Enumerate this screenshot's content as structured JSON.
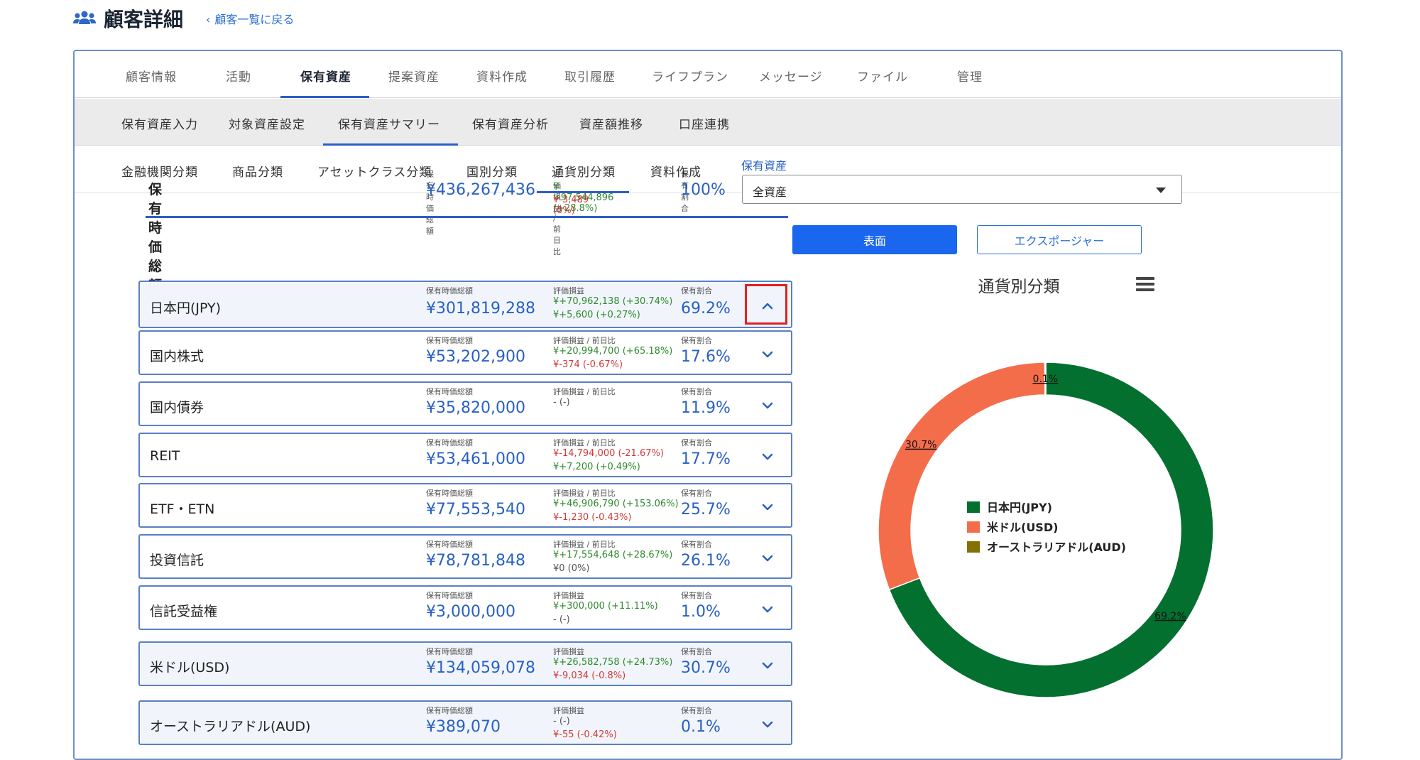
{
  "header": {
    "title": "顧客詳細",
    "back_link": "顧客一覧に戻る"
  },
  "tabs_primary": [
    "顧客情報",
    "活動",
    "保有資産",
    "提案資産",
    "資料作成",
    "取引履歴",
    "ライフプラン",
    "メッセージ",
    "ファイル",
    "管理"
  ],
  "tabs_secondary": [
    "保有資産入力",
    "対象資産設定",
    "保有資産サマリー",
    "保有資産分析",
    "資産額推移",
    "口座連携"
  ],
  "tabs_tertiary": [
    "金融機関分類",
    "商品分類",
    "アセットクラス分類",
    "国別分類",
    "通貨別分類",
    "資料作成"
  ],
  "summary": {
    "title": "保有時価総額",
    "value_label": "保有時価総額",
    "value": "¥436,267,436",
    "pl_label": "評価損益 / 前日比",
    "pl": "¥+97,544,896 (+28.8%)",
    "day": "¥-3,489 (0%)",
    "ratio_label": "保有割合",
    "ratio": "100%"
  },
  "rows": [
    {
      "label": "日本円(JPY)",
      "value_label": "保有時価総額",
      "value": "¥301,819,288",
      "pl_label": "評価損益",
      "pl": "¥+70,962,138 (+30.74%)",
      "day": "¥+5,600 (+0.27%)",
      "ratio_label": "保有割合",
      "ratio": "69.2%"
    },
    {
      "label": "国内株式",
      "value_label": "保有時価総額",
      "value": "¥53,202,900",
      "pl_label": "評価損益 / 前日比",
      "pl": "¥+20,994,700 (+65.18%)",
      "day": "¥-374 (-0.67%)",
      "ratio_label": "保有割合",
      "ratio": "17.6%"
    },
    {
      "label": "国内債券",
      "value_label": "保有時価総額",
      "value": "¥35,820,000",
      "pl_label": "評価損益 / 前日比",
      "pl": "- (-)",
      "day": "",
      "ratio_label": "保有割合",
      "ratio": "11.9%"
    },
    {
      "label": "REIT",
      "value_label": "保有時価総額",
      "value": "¥53,461,000",
      "pl_label": "評価損益 / 前日比",
      "pl": "¥-14,794,000 (-21.67%)",
      "day": "¥+7,200 (+0.49%)",
      "ratio_label": "保有割合",
      "ratio": "17.7%"
    },
    {
      "label": "ETF・ETN",
      "value_label": "保有時価総額",
      "value": "¥77,553,540",
      "pl_label": "評価損益 / 前日比",
      "pl": "¥+46,906,790 (+153.06%)",
      "day": "¥-1,230 (-0.43%)",
      "ratio_label": "保有割合",
      "ratio": "25.7%"
    },
    {
      "label": "投資信託",
      "value_label": "保有時価総額",
      "value": "¥78,781,848",
      "pl_label": "評価損益 / 前日比",
      "pl": "¥+17,554,648 (+28.67%)",
      "day": "¥0 (0%)",
      "ratio_label": "保有割合",
      "ratio": "26.1%"
    },
    {
      "label": "信託受益権",
      "value_label": "保有時価総額",
      "value": "¥3,000,000",
      "pl_label": "評価損益",
      "pl": "¥+300,000 (+11.11%)",
      "day": "- (-)",
      "ratio_label": "保有割合",
      "ratio": "1.0%"
    },
    {
      "label": "米ドル(USD)",
      "value_label": "保有時価総額",
      "value": "¥134,059,078",
      "pl_label": "評価損益",
      "pl": "¥+26,582,758 (+24.73%)",
      "day": "¥-9,034 (-0.8%)",
      "ratio_label": "保有割合",
      "ratio": "30.7%"
    },
    {
      "label": "オーストラリアドル(AUD)",
      "value_label": "保有時価総額",
      "value": "¥389,070",
      "pl_label": "評価損益",
      "pl": "- (-)",
      "day": "¥-55 (-0.42%)",
      "ratio_label": "保有割合",
      "ratio": "0.1%"
    }
  ],
  "right_panel": {
    "select_label": "保有資産",
    "select_value": "全資産",
    "btn_primary": "表面",
    "btn_outline": "エクスポージャー"
  },
  "chart_data": {
    "type": "pie",
    "title": "通貨別分類",
    "series": [
      {
        "name": "日本円(JPY)",
        "value": 69.2,
        "label": "69.2%",
        "color": "#037030"
      },
      {
        "name": "米ドル(USD)",
        "value": 30.7,
        "label": "30.7%",
        "color": "#f46d4b"
      },
      {
        "name": "オーストラリアドル(AUD)",
        "value": 0.1,
        "label": "0.1%",
        "color": "#857101"
      }
    ],
    "legend_position": "center"
  },
  "colors": {
    "accent": "#2b5fc4",
    "primary_button": "#1a66ee",
    "positive": "#2e8a2e",
    "negative": "#d23a3a"
  }
}
